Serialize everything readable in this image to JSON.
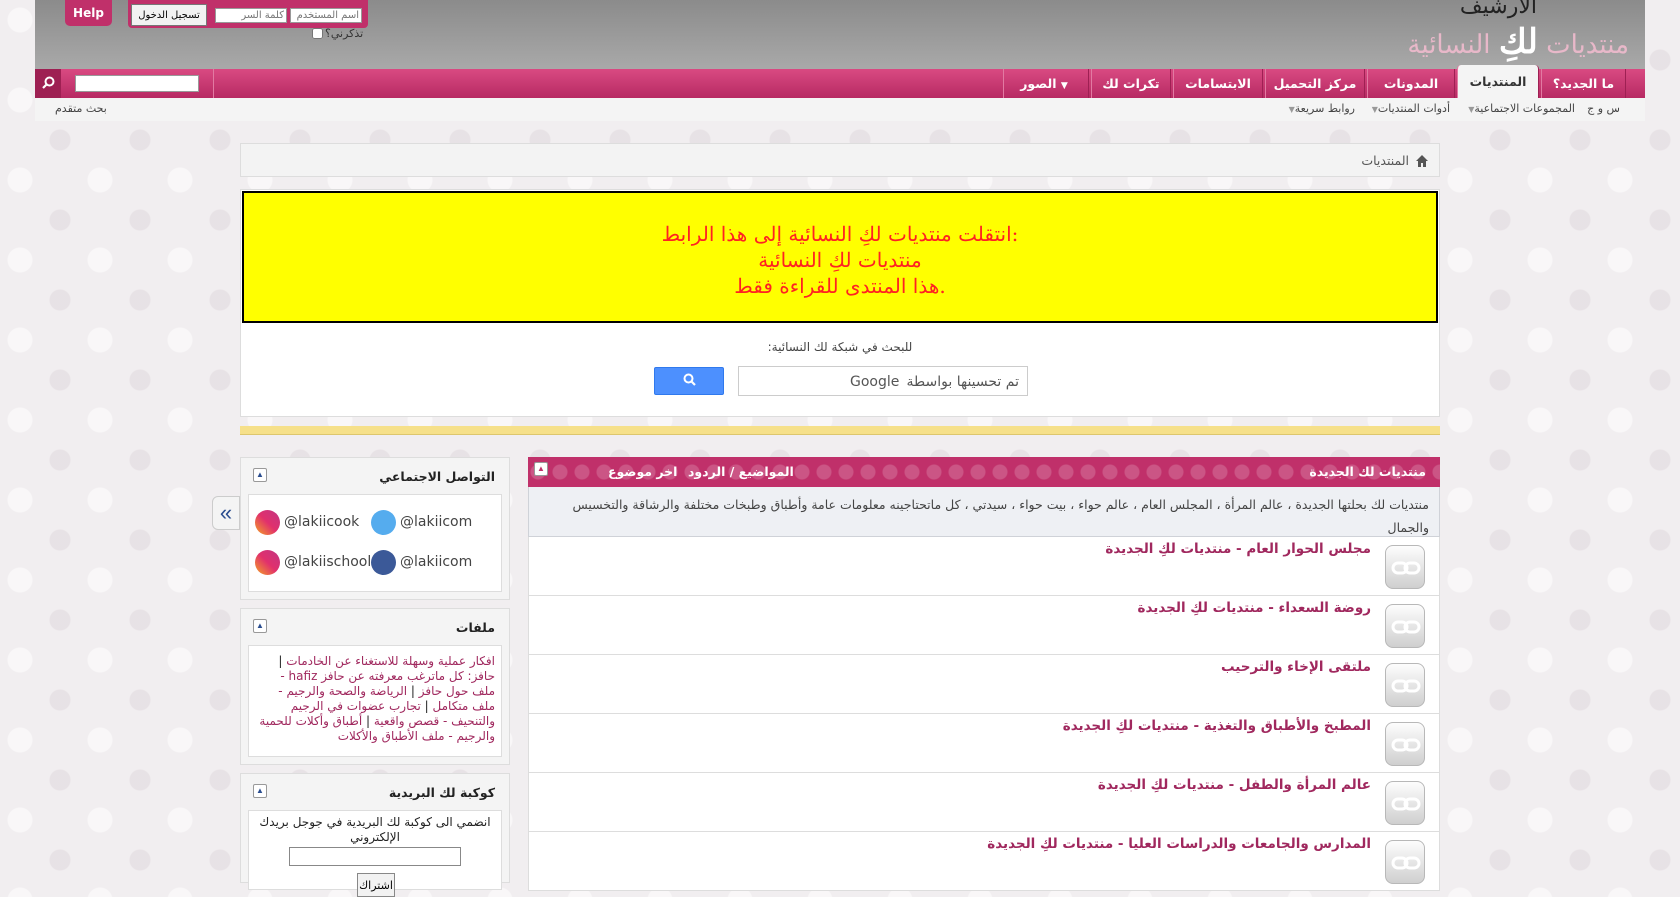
{
  "header": {
    "logo_archive": "الأرشيف",
    "logo_name_prefix": "منتديات",
    "logo_name_main": "لكِ",
    "logo_name_suffix": "النسائية",
    "help_label": "Help",
    "login": {
      "username_placeholder": "اسم المستخدم",
      "password_placeholder": "كلمة السر",
      "submit_label": "تسجيل الدخول",
      "remember_label": "تذكرني؟"
    }
  },
  "nav": {
    "tabs": [
      {
        "label": "ما الجديد؟"
      },
      {
        "label": "المنتديات"
      },
      {
        "label": "المدونات"
      },
      {
        "label": "مركز التحميل"
      },
      {
        "label": "الابتسامات"
      },
      {
        "label": "تكرات لك"
      },
      {
        "label": "الصور"
      }
    ],
    "search_value": ""
  },
  "subnav": {
    "faq": "س و ج",
    "social_groups": "المجموعات الاجتماعية",
    "forum_tools": "أدوات المنتديات",
    "quick_links": "روابط سريعة",
    "advanced_search": "بحث متقدم"
  },
  "breadcrumb": {
    "label": "المنتديات"
  },
  "notice": {
    "line1": "انتقلت منتديات لكِ النسائية إلى هذا الرابط:",
    "line2": "منتديات لكِ النسائية",
    "line3": "هذا المنتدى للقراءة فقط."
  },
  "google_search": {
    "label": "للبحث في شبكة لك النسائية:",
    "brand_prefix": "تم تحسينها بواسطة",
    "brand_name": "Google"
  },
  "forums": {
    "title": "منتديات لك الجديدة",
    "col_stats": "المواضيع / الردود",
    "col_last": "اخر موضوع",
    "description": "منتديات لك بحلتها الجديدة ، عالم المرأة ، المجلس العام ، عالم حواء ، بيت حواء ، سيدتي ، كل ماتحتاجينه معلومات عامة وأطباق وطبخات مختلفة والرشاقة والتخسيس والجمال",
    "rows": [
      {
        "label": "مجلس الحوار العام - منتديات لكِ الجديدة"
      },
      {
        "label": "روضة السعداء - منتديات لكِ الجديدة"
      },
      {
        "label": "ملتقى الإخاء والترحيب"
      },
      {
        "label": "المطبخ والأطباق والتغذية - منتديات لكِ الجديدة"
      },
      {
        "label": "عالم المرأة والطفل - منتديات لكِ الجديدة"
      },
      {
        "label": "المدارس والجامعات والدراسات العليا - منتديات لكِ الجديدة"
      }
    ]
  },
  "sidebar": {
    "toggle_label": "«",
    "social": {
      "title": "التواصل الاجتماعي",
      "items": [
        {
          "handle": "@lakiicom",
          "icon": "twitter-icon"
        },
        {
          "handle": "@lakiicook",
          "icon": "instagram-icon"
        },
        {
          "handle": "@lakiicom",
          "icon": "facebook-icon"
        },
        {
          "handle": "@lakiischool",
          "icon": "instagram-icon"
        }
      ]
    },
    "files": {
      "title": "ملفات",
      "links": [
        "افكار عملية وسهلة للاستغناء عن الخادمات",
        "حافز: كل ماترغب معرفته عن حافز hafiz - ملف حول حافز",
        "الرياضة والصحة والرجيم - ملف متكامل",
        "تجارب عضوات في الرجيم والتنحيف - قصص واقعية",
        "أطباق وأكلات للحمية والرجيم - ملف الأطباق والأكلات"
      ],
      "separator": " | "
    },
    "mail": {
      "title": "كوكبة لك البريدية",
      "text": "انضمي الى كوكبة لك البريدية في جوجل بريدك الإلكتروني",
      "submit_label": "اشتراك"
    }
  },
  "colors": {
    "brand_pink": "#c0306a",
    "link_pink": "#a0285e",
    "notice_yellow": "#ffff00",
    "notice_red": "#ff2222"
  }
}
